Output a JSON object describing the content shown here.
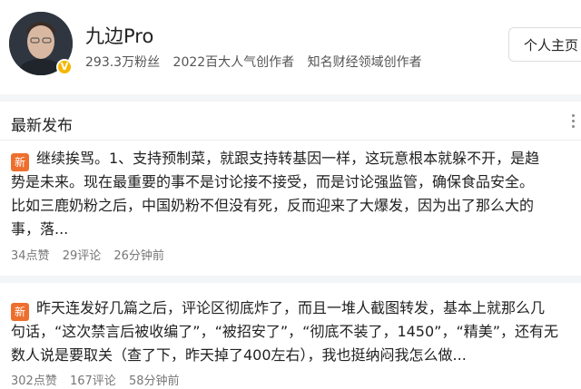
{
  "profile": {
    "name": "九边Pro",
    "followers": "293.3万粉丝",
    "tag1": "2022百大人气创作者",
    "tag2": "知名财经领域创作者",
    "home_button": "个人主页",
    "verified_mark": "V"
  },
  "section": {
    "title": "最新发布"
  },
  "posts": [
    {
      "badge": "新",
      "lines": [
        "继续挨骂。1、支持预制菜，就跟支持转基因一样，这玩意根本就躲不开，是趋",
        "势是未来。现在最重要的事不是讨论接不接受，而是讨论强监管，确保食品安全。",
        "比如三鹿奶粉之后，中国奶粉不但没有死，反而迎来了大爆发，因为出了那么大的",
        "事，落..."
      ],
      "likes": "34点赞",
      "comments": "29评论",
      "time": "26分钟前"
    },
    {
      "badge": "新",
      "lines": [
        "昨天连发好几篇之后，评论区彻底炸了，而且一堆人截图转发，基本上就那么几",
        "句话，“这次禁言后被收编了”，“被招安了”，“彻底不装了，1450”，“精美”，还有无",
        "数人说是要取关（查了下，昨天掉了400左右），我也挺纳闷我怎么做..."
      ],
      "likes": "302点赞",
      "comments": "167评论",
      "time": "58分钟前"
    }
  ]
}
